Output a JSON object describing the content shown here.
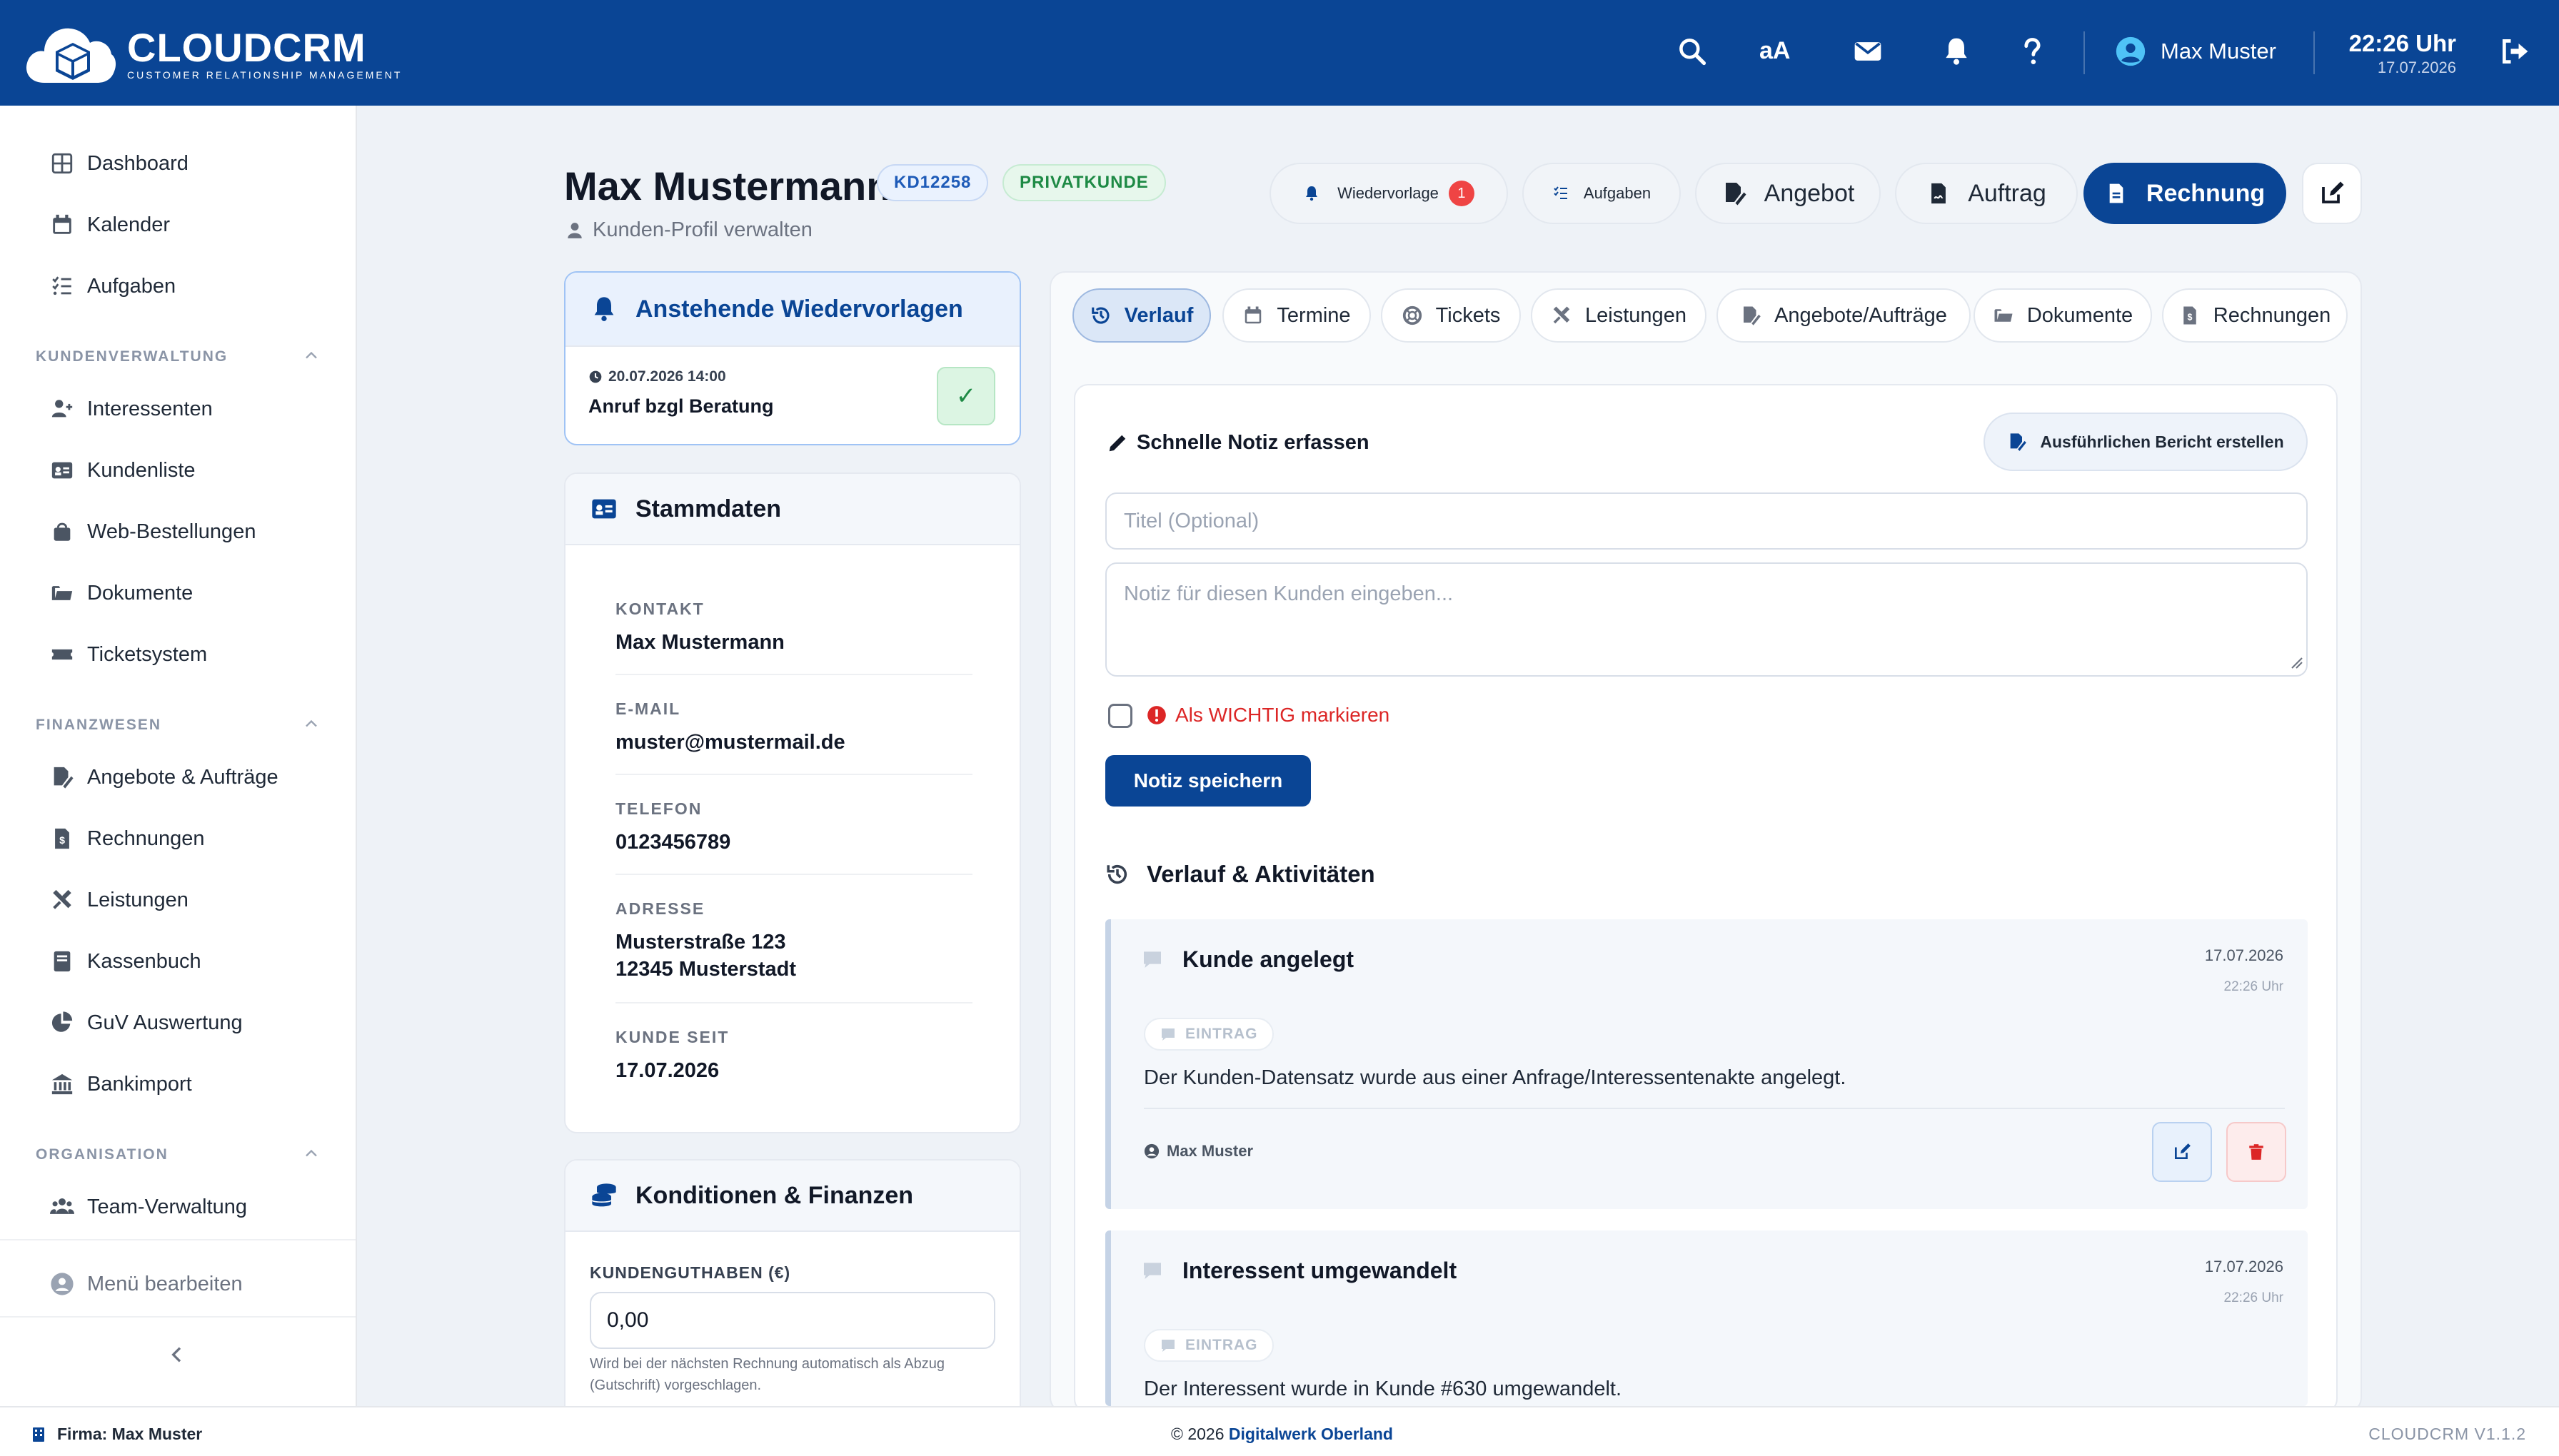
{
  "app": {
    "logo_title": "CLOUDCRM",
    "logo_subtitle": "CUSTOMER RELATIONSHIP MANAGEMENT",
    "brand_color": "#0a4595"
  },
  "topbar": {
    "font_size_label": "aA",
    "user_name": "Max Muster",
    "time": "22:26 Uhr",
    "date": "17.07.2026",
    "icons": [
      "search-icon",
      "mail-icon",
      "bell-icon",
      "help-icon",
      "user-circle-icon",
      "logout-icon"
    ]
  },
  "sidebar": {
    "top_items": [
      {
        "label": "Dashboard",
        "icon": "grid-icon"
      },
      {
        "label": "Kalender",
        "icon": "calendar-icon"
      },
      {
        "label": "Aufgaben",
        "icon": "tasks-icon"
      }
    ],
    "sections": [
      {
        "title": "KUNDENVERWALTUNG",
        "items": [
          {
            "label": "Interessenten",
            "icon": "user-plus-icon"
          },
          {
            "label": "Kundenliste",
            "icon": "id-card-icon"
          },
          {
            "label": "Web-Bestellungen",
            "icon": "bag-icon"
          },
          {
            "label": "Dokumente",
            "icon": "folder-icon"
          },
          {
            "label": "Ticketsystem",
            "icon": "ticket-icon"
          }
        ]
      },
      {
        "title": "FINANZWESEN",
        "items": [
          {
            "label": "Angebote & Aufträge",
            "icon": "file-signature-icon"
          },
          {
            "label": "Rechnungen",
            "icon": "invoice-icon"
          },
          {
            "label": "Leistungen",
            "icon": "tools-icon"
          },
          {
            "label": "Kassenbuch",
            "icon": "book-icon"
          },
          {
            "label": "GuV Auswertung",
            "icon": "pie-chart-icon"
          },
          {
            "label": "Bankimport",
            "icon": "bank-icon"
          }
        ]
      },
      {
        "title": "ORGANISATION",
        "items": [
          {
            "label": "Team-Verwaltung",
            "icon": "users-icon"
          }
        ]
      }
    ],
    "edit_menu_label": "Menü bearbeiten"
  },
  "customer": {
    "name": "Max Mustermann",
    "id_badge": "KD12258",
    "type_badge": "PRIVATKUNDE",
    "subtitle": "Kunden-Profil verwalten"
  },
  "header_buttons": {
    "wiedervorlage": "Wiedervorlage",
    "wiedervorlage_count": "1",
    "aufgaben": "Aufgaben",
    "angebot": "Angebot",
    "auftrag": "Auftrag",
    "rechnung": "Rechnung"
  },
  "reminders": {
    "title": "Anstehende Wiedervorlagen",
    "items": [
      {
        "datetime": "20.07.2026 14:00",
        "text": "Anruf bzgl Beratung",
        "done_glyph": "✓"
      }
    ]
  },
  "stammdaten": {
    "title": "Stammdaten",
    "fields": [
      {
        "label": "KONTAKT",
        "value": "Max Mustermann"
      },
      {
        "label": "E-MAIL",
        "value": "muster@mustermail.de"
      },
      {
        "label": "TELEFON",
        "value": "0123456789"
      },
      {
        "label": "ADRESSE",
        "value_line1": "Musterstraße 123",
        "value_line2": "12345 Musterstadt"
      },
      {
        "label": "KUNDE SEIT",
        "value": "17.07.2026"
      }
    ]
  },
  "finanzen": {
    "title": "Konditionen & Finanzen",
    "guthaben_label": "KUNDENGUTHABEN (€)",
    "guthaben_value": "0,00",
    "guthaben_hint": "Wird bei der nächsten Rechnung automatisch als Abzug (Gutschrift) vorgeschlagen."
  },
  "tabs": [
    {
      "label": "Verlauf",
      "icon": "history-icon",
      "active": true
    },
    {
      "label": "Termine",
      "icon": "calendar-icon",
      "active": false
    },
    {
      "label": "Tickets",
      "icon": "lifebuoy-icon",
      "active": false
    },
    {
      "label": "Leistungen",
      "icon": "tools-icon",
      "active": false
    },
    {
      "label": "Angebote/Aufträge",
      "icon": "file-signature-icon",
      "active": false
    },
    {
      "label": "Dokumente",
      "icon": "folder-icon",
      "active": false
    },
    {
      "label": "Rechnungen",
      "icon": "invoice-icon",
      "active": false
    }
  ],
  "note": {
    "title": "Schnelle Notiz erfassen",
    "report_button": "Ausführlichen Bericht erstellen",
    "title_placeholder": "Titel (Optional)",
    "body_placeholder": "Notiz für diesen Kunden eingeben...",
    "important_label": "Als WICHTIG markieren",
    "save_button": "Notiz speichern"
  },
  "history": {
    "title": "Verlauf & Aktivitäten",
    "entries": [
      {
        "title": "Kunde angelegt",
        "date": "17.07.2026",
        "time": "22:26 Uhr",
        "tag": "EINTRAG",
        "text": "Der Kunden-Datensatz wurde aus einer Anfrage/Interessentenakte angelegt.",
        "author": "Max Muster"
      },
      {
        "title": "Interessent umgewandelt",
        "date": "17.07.2026",
        "time": "22:26 Uhr",
        "tag": "EINTRAG",
        "text": "Der Interessent wurde in Kunde #630 umgewandelt."
      }
    ]
  },
  "footer": {
    "company": "Firma: Max Muster",
    "copyright": "© 2026",
    "copyright_link": "Digitalwerk Oberland",
    "version": "CLOUDCRM V1.1.2"
  }
}
